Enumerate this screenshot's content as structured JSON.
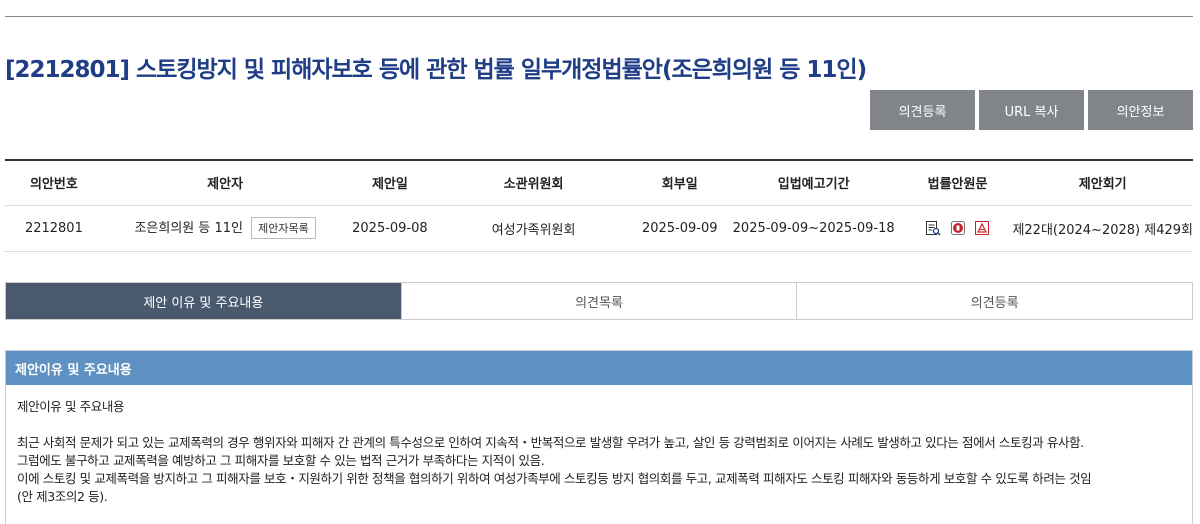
{
  "bill": {
    "title": "[2212801] 스토킹방지 및 피해자보호 등에 관한 법률 일부개정법률안(조은희의원 등 11인)"
  },
  "actions": {
    "opinion_register": "의견등록",
    "url_copy": "URL 복사",
    "bill_info": "의안정보"
  },
  "table": {
    "headers": [
      "의안번호",
      "제안자",
      "제안일",
      "소관위원회",
      "회부일",
      "입법예고기간",
      "법률안원문",
      "제안회기"
    ],
    "row": {
      "bill_no": "2212801",
      "proposer": "조은희의원 등 11인",
      "proposer_list_btn": "제안자목록",
      "proposal_date": "2025-09-08",
      "committee": "여성가족위원회",
      "referral_date": "2025-09-09",
      "notice_period": "2025-09-09~2025-09-18",
      "session": "제22대(2024~2028) 제429회"
    },
    "file_icons": [
      "document-search-icon",
      "hwp-file-icon",
      "pdf-file-icon"
    ]
  },
  "tabs": [
    {
      "label": "제안 이유 및 주요내용",
      "active": true
    },
    {
      "label": "의견목록",
      "active": false
    },
    {
      "label": "의견등록",
      "active": false
    }
  ],
  "panel": {
    "header": "제안이유 및 주요내용",
    "subtitle": "제안이유 및 주요내용",
    "lines": [
      "최근 사회적 문제가 되고 있는 교제폭력의 경우 행위자와 피해자 간 관계의 특수성으로 인하여 지속적・반복적으로 발생할 우려가 높고, 살인 등 강력범죄로 이어지는 사례도 발생하고 있다는 점에서 스토킹과 유사함.",
      "그럼에도 불구하고 교제폭력을 예방하고 그 피해자를 보호할 수 있는 법적 근거가 부족하다는 지적이 있음.",
      "이에 스토킹 및 교제폭력을 방지하고 그 피해자를 보호・지원하기 위한 정책을 협의하기 위하여 여성가족부에 스토킹등 방지 협의회를 두고, 교제폭력 피해자도 스토킹 피해자와 동등하게 보호할 수 있도록 하려는 것임",
      "(안 제3조의2 등)."
    ]
  },
  "colors": {
    "title": "#1f3e86",
    "button_bg": "#818589",
    "tab_active": "#4a5a6e",
    "panel_header": "#5f91c2"
  }
}
